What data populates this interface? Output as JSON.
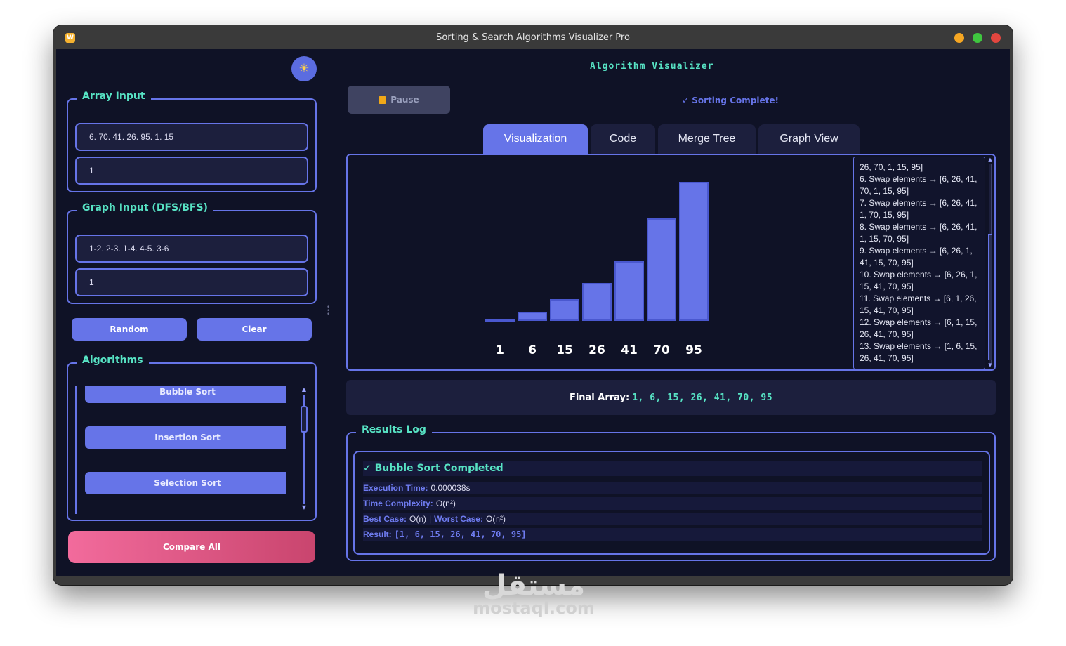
{
  "window": {
    "title": "Sorting & Search Algorithms Visualizer Pro"
  },
  "left": {
    "array_input": {
      "title": "Array Input",
      "values": "6. 70. 41. 26. 95. 1. 15",
      "target": "1"
    },
    "graph_input": {
      "title": "Graph Input (DFS/BFS)",
      "edges": "1-2. 2-3. 1-4. 4-5. 3-6",
      "start": "1"
    },
    "random_label": "Random",
    "clear_label": "Clear",
    "algorithms": {
      "title": "Algorithms",
      "items": [
        "Bubble Sort",
        "Insertion Sort",
        "Selection Sort"
      ]
    },
    "compare_label": "Compare All"
  },
  "right": {
    "title": "Algorithm Visualizer",
    "pause_label": "Pause",
    "status": "✓ Sorting Complete!",
    "tabs": [
      "Visualization",
      "Code",
      "Merge Tree",
      "Graph View"
    ],
    "active_tab": "Visualization",
    "bars": [
      {
        "label": "1",
        "value": 1
      },
      {
        "label": "6",
        "value": 6
      },
      {
        "label": "15",
        "value": 15
      },
      {
        "label": "26",
        "value": 26
      },
      {
        "label": "41",
        "value": 41
      },
      {
        "label": "70",
        "value": 70
      },
      {
        "label": "95",
        "value": 95
      }
    ],
    "steps": [
      "26, 70, 1, 15, 95]",
      "6. Swap elements → [6, 26, 41, 70, 1, 15, 95]",
      "7. Swap elements → [6, 26, 41, 1, 70, 15, 95]",
      "8. Swap elements → [6, 26, 41, 1, 15, 70, 95]",
      "9. Swap elements → [6, 26, 1, 41, 15, 70, 95]",
      "10. Swap elements → [6, 26, 1, 15, 41, 70, 95]",
      "11. Swap elements → [6, 1, 26, 15, 41, 70, 95]",
      "12. Swap elements → [6, 1, 15, 26, 41, 70, 95]",
      "13. Swap elements → [1, 6, 15, 26, 41, 70, 95]"
    ],
    "final_label": "Final Array:",
    "final_value": "1, 6, 15, 26, 41, 70, 95",
    "results": {
      "title": "Results Log",
      "heading": "✓ Bubble Sort Completed",
      "exec_label": "Execution Time:",
      "exec_value": "0.000038s",
      "time_label": "Time Complexity:",
      "time_value": "O(n²)",
      "best_label": "Best Case:",
      "best_value": "O(n)",
      "sep": "|",
      "worst_label": "Worst Case:",
      "worst_value": "O(n²)",
      "result_label": "Result:",
      "result_value": "[1, 6, 15, 26, 41, 70, 95]"
    }
  },
  "watermark": {
    "arabic": "مستقل",
    "latin": "mostaql.com"
  },
  "icons": {
    "app": "app-icon",
    "theme": "sun-icon",
    "pause": "pause-icon"
  },
  "colors": {
    "accent": "#6674e8",
    "teal": "#57e3c4",
    "background": "#0f1226",
    "compare_start": "#f26b9c",
    "compare_end": "#c9456e"
  }
}
